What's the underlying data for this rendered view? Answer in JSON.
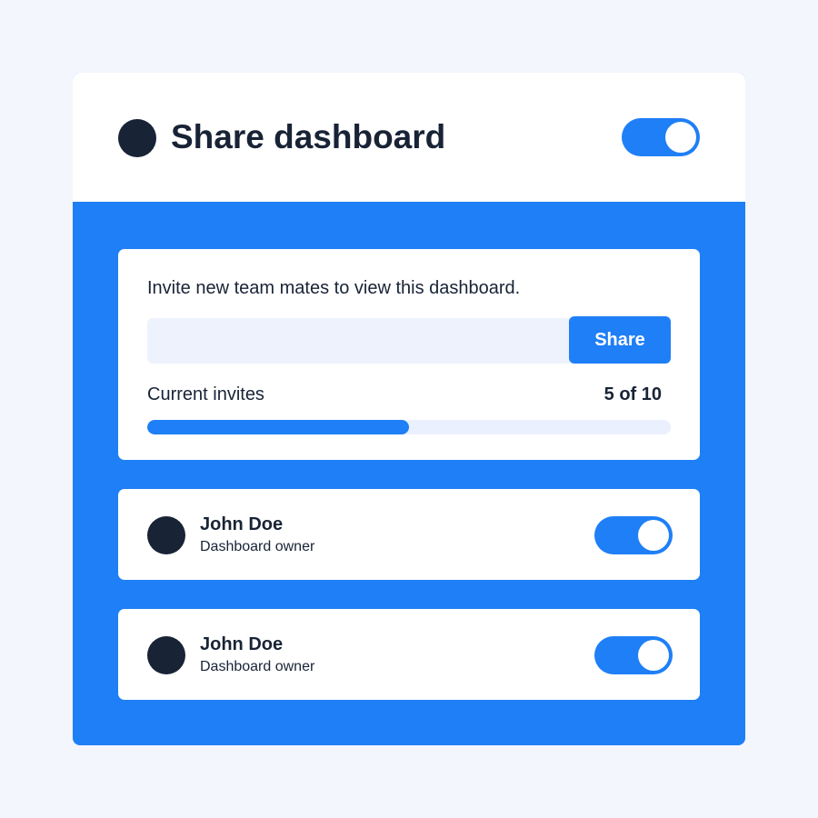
{
  "share_panel": {
    "title": "Share dashboard",
    "header_toggle_enabled": true,
    "invite": {
      "instruction": "Invite new team mates to view this dashboard.",
      "input_value": "",
      "share_label": "Share",
      "current_invites_label": "Current invites",
      "invite_count_text": "5 of 10",
      "invites_used": 5,
      "invites_limit": 10,
      "progress_fraction": 0.5
    },
    "members": [
      {
        "name": "John Doe",
        "role": "Dashboard owner",
        "toggle_enabled": true
      },
      {
        "name": "John Doe",
        "role": "Dashboard owner",
        "toggle_enabled": true
      }
    ],
    "colors": {
      "accent": "#1f7ff6",
      "dark": "#182336",
      "input_background": "#eef2fd",
      "page_background": "#f3f6fd"
    },
    "icons": {
      "header_avatar": "avatar-icon",
      "member_avatar": "avatar-icon",
      "toggle": "toggle-switch-icon"
    }
  }
}
